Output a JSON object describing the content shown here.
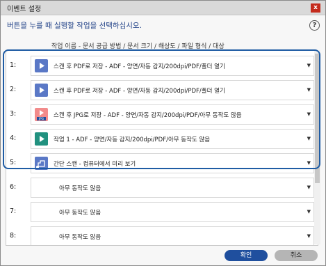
{
  "window": {
    "title": "이벤트 설정",
    "close_label": "x"
  },
  "instruction": "버튼을 누를 때 실행할 작업을 선택하십시오.",
  "help_label": "?",
  "column_header": "작업 이름 - 문서 공급 방법 / 문서 크기 / 해상도 / 파일 형식 / 대상",
  "rows": [
    {
      "num": "1:",
      "text": "스캔 후 PDF로 저장 - ADF - 양면/자동 감지/200dpi/PDF/폴더 열기",
      "icon": "pdf-doc-icon"
    },
    {
      "num": "2:",
      "text": "스캔 후 PDF로 저장 - ADF - 양면/자동 감지/200dpi/PDF/폴더 열기",
      "icon": "pdf-doc-icon"
    },
    {
      "num": "3:",
      "text": "스캔 후 JPG로 저장 - ADF - 양면/자동 감지/200dpi/PDF/아무 동작도 않음",
      "icon": "jpg-doc-icon",
      "badge": "JPG"
    },
    {
      "num": "4:",
      "text": "작업 1 - ADF - 양면/자동 감지/200dpi/PDF/아무 동작도 않음",
      "icon": "job-doc-icon"
    },
    {
      "num": "5:",
      "text": "간단 스캔 - 컴퓨터에서 미리 보기",
      "icon": "simple-scan-icon"
    },
    {
      "num": "6:",
      "text": "아무 동작도 않음"
    },
    {
      "num": "7:",
      "text": "아무 동작도 않음"
    },
    {
      "num": "8:",
      "text": "아무 동작도 않음"
    }
  ],
  "buttons": {
    "ok": "확인",
    "cancel": "취소"
  },
  "colors": {
    "accent": "#1f5ca4",
    "pdf_icon": "#5a78c6",
    "jpg_icon": "#f28b8b",
    "job_icon": "#21917f",
    "ok_button": "#1f4f9e"
  }
}
